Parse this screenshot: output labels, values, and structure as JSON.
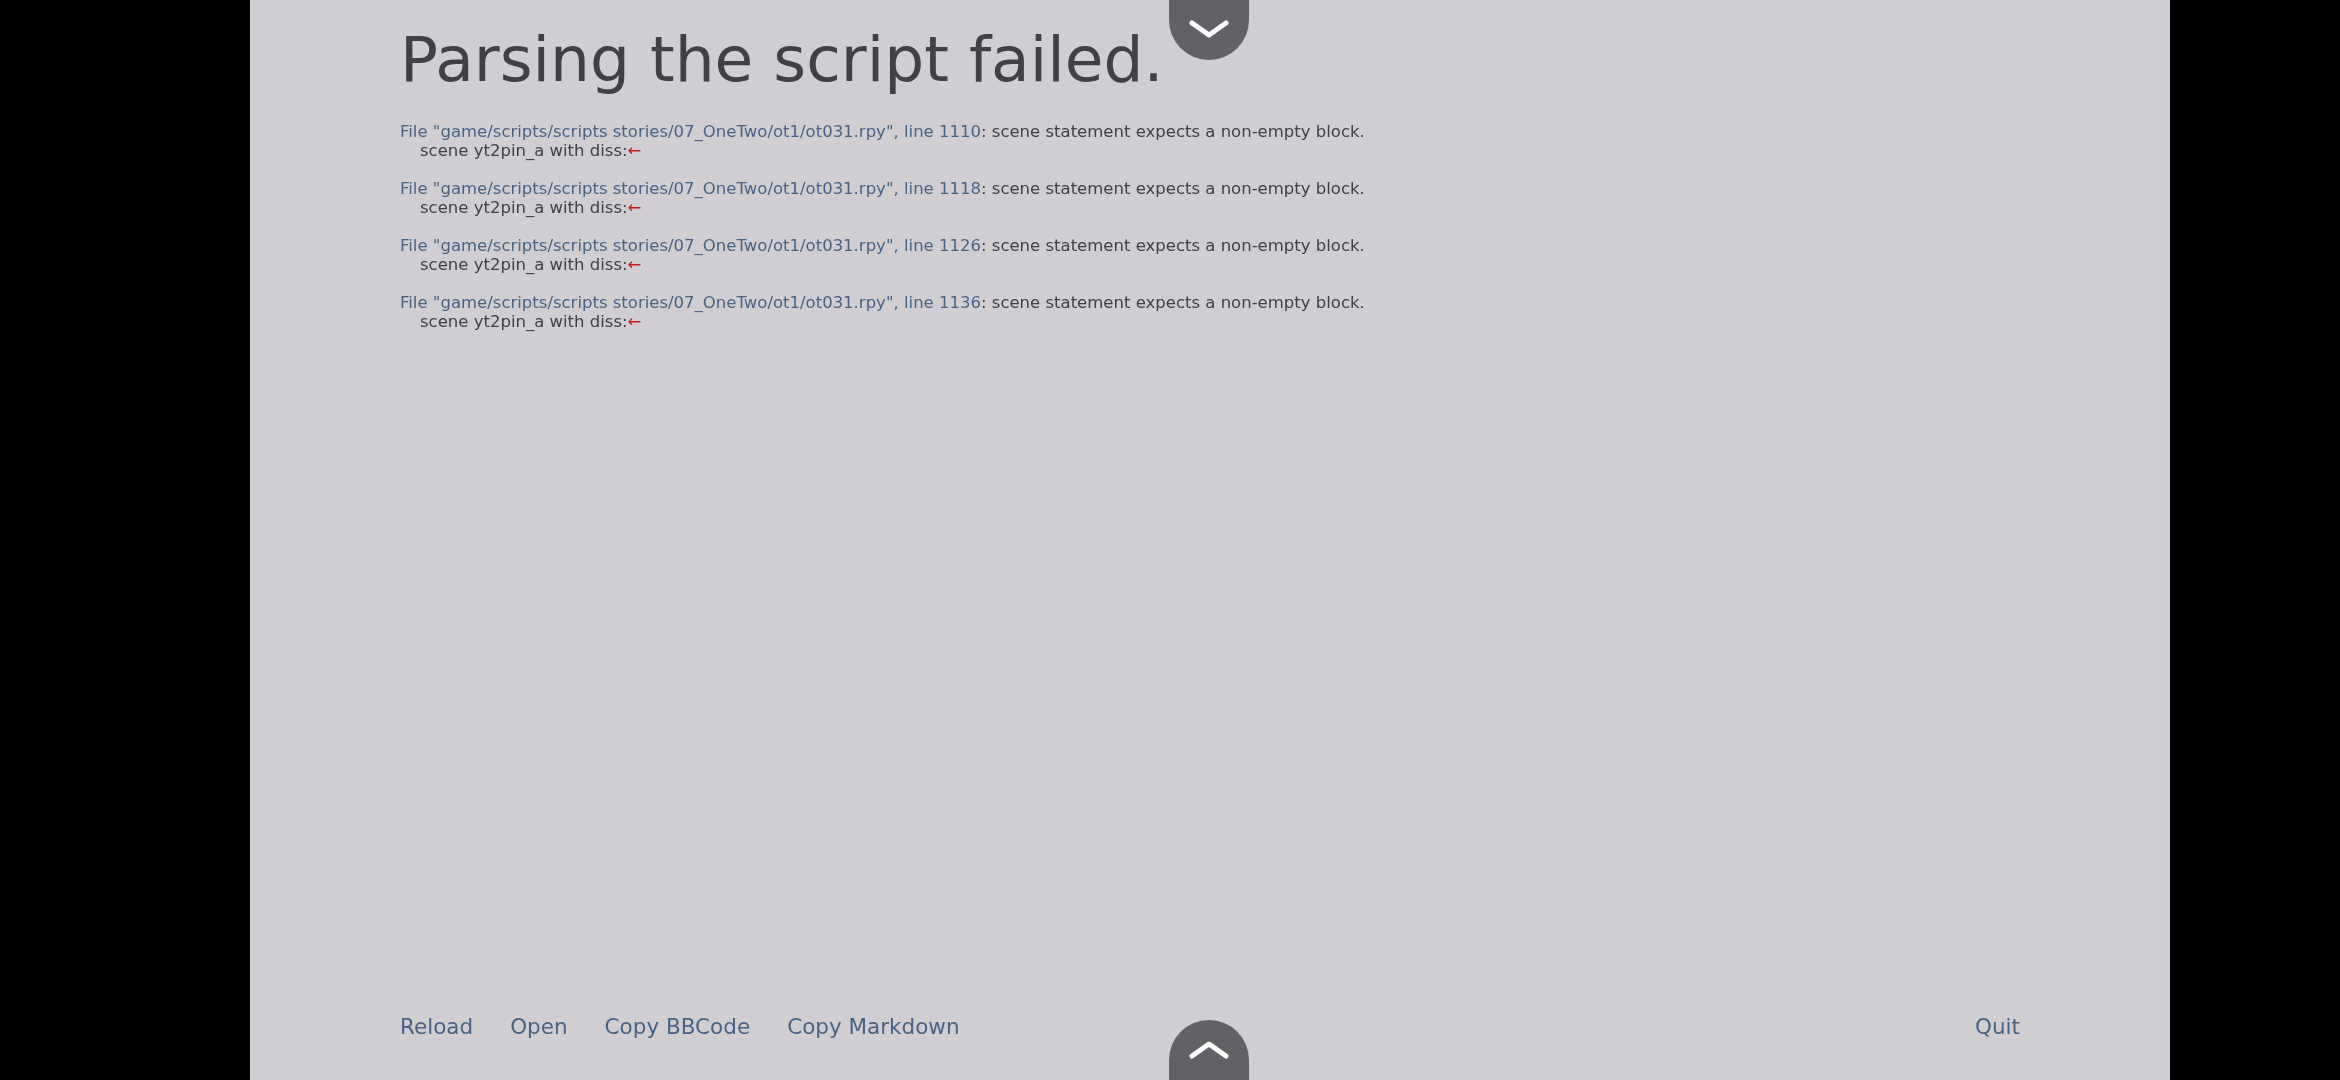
{
  "title": "Parsing the script failed.",
  "errors": [
    {
      "location": "File \"game/scripts/scripts stories/07_OneTwo/ot1/ot031.rpy\", line 1110",
      "message": ": scene statement expects a non-empty block.",
      "code": "scene yt2pin_a with diss:",
      "marker": "←"
    },
    {
      "location": "File \"game/scripts/scripts stories/07_OneTwo/ot1/ot031.rpy\", line 1118",
      "message": ": scene statement expects a non-empty block.",
      "code": "scene yt2pin_a with diss:",
      "marker": "←"
    },
    {
      "location": "File \"game/scripts/scripts stories/07_OneTwo/ot1/ot031.rpy\", line 1126",
      "message": ": scene statement expects a non-empty block.",
      "code": "scene yt2pin_a with diss:",
      "marker": "←"
    },
    {
      "location": "File \"game/scripts/scripts stories/07_OneTwo/ot1/ot031.rpy\", line 1136",
      "message": ": scene statement expects a non-empty block.",
      "code": "scene yt2pin_a with diss:",
      "marker": "←"
    }
  ],
  "actions": [
    "Reload",
    "Open",
    "Copy BBCode",
    "Copy Markdown"
  ],
  "quit": "Quit"
}
